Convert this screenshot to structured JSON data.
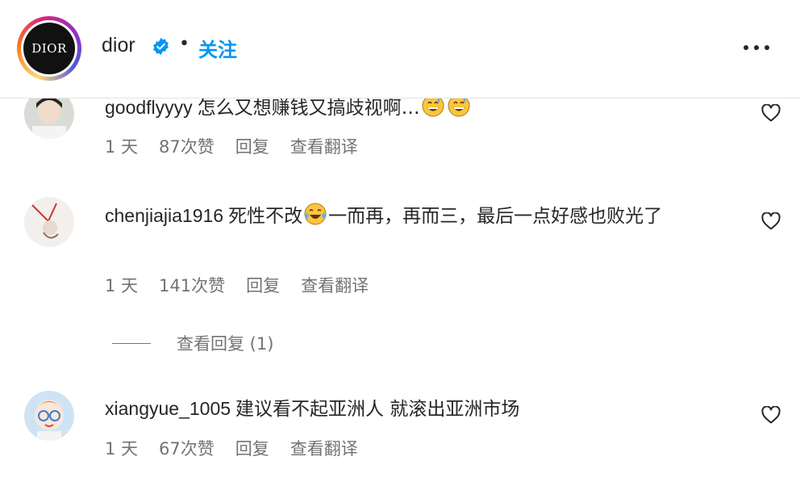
{
  "header": {
    "avatar_text": "DIOR",
    "username": "dior",
    "separator": "•",
    "follow_label": "关注"
  },
  "comments": [
    {
      "username": "goodflyyyy",
      "text": "怎么又想赚钱又搞歧视啊…",
      "emojis": [
        "grinning-sweat-face",
        "grinning-sweat-face"
      ],
      "time": "1 天",
      "likes": "87次赞",
      "reply_label": "回复",
      "translate_label": "查看翻译"
    },
    {
      "username": "chenjiajia1916",
      "text_before_emoji": "死性不改",
      "emojis": [
        "tears-of-joy-face"
      ],
      "text_after_emoji": "一而再，再而三，最后一点好感也败光了",
      "time": "1 天",
      "likes": "141次赞",
      "reply_label": "回复",
      "translate_label": "查看翻译",
      "view_replies": "查看回复 (1)"
    },
    {
      "username": "xiangyue_1005",
      "text": "建议看不起亚洲人 就滚出亚洲市场",
      "time": "1 天",
      "likes": "67次赞",
      "reply_label": "回复",
      "translate_label": "查看翻译"
    }
  ],
  "colors": {
    "accent": "#0095f6",
    "text": "#262626",
    "muted": "#737373"
  }
}
